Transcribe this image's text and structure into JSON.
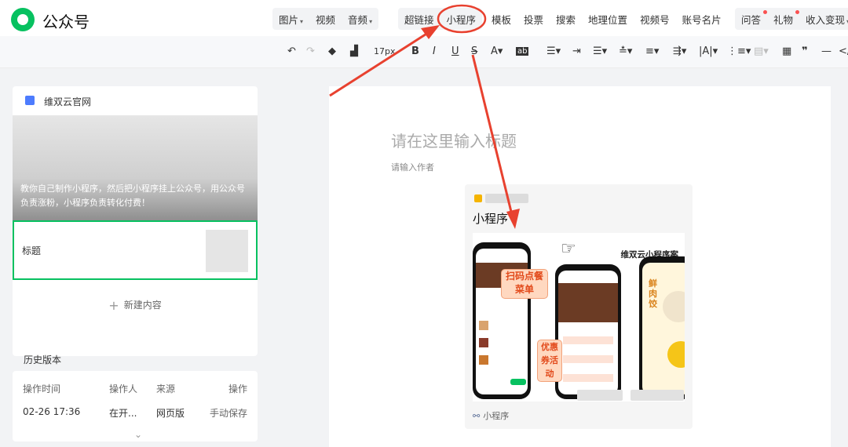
{
  "app": {
    "brand": "公众号",
    "logo_icon": "wechat-official-account-logo-icon"
  },
  "menu": {
    "group1": [
      "图片",
      "视频",
      "音频"
    ],
    "group2": [
      "超链接",
      "小程序",
      "模板",
      "投票",
      "搜索",
      "地理位置",
      "视频号",
      "账号名片"
    ],
    "plain": [
      "问答",
      "礼物",
      "收入变现"
    ],
    "highlighted": "小程序"
  },
  "toolbar": {
    "font_size": "17px",
    "icons": [
      "undo-icon",
      "redo-icon",
      "format-painter-icon",
      "clear-format-icon",
      "bold-icon",
      "italic-icon",
      "underline-icon",
      "strikethrough-icon",
      "font-color-icon",
      "background-color-icon",
      "align-icon",
      "indent-icon",
      "line-height-icon",
      "letter-spacing-icon",
      "paragraph-spacing-icon",
      "margin-icon",
      "text-direction-icon",
      "list-icon",
      "ordered-list-icon",
      "table-icon",
      "quote-icon",
      "divider-icon",
      "code-icon"
    ]
  },
  "left_panel": {
    "account_name": "维双云官网",
    "cover_text": "教你自己制作小程序，然后把小程序挂上公众号，用公众号负责涨粉，小程序负责转化付费！",
    "item_title": "标题",
    "new_content": "新建内容"
  },
  "history": {
    "title": "历史版本",
    "headers": [
      "操作时间",
      "操作人",
      "来源",
      "操作"
    ],
    "rows": [
      [
        "02-26 17:36",
        "在开...",
        "网页版",
        "手动保存"
      ]
    ]
  },
  "editor": {
    "title_placeholder": "请在这里输入标题",
    "author_placeholder": "请输入作者",
    "mini_program_label": "小程序",
    "mini_program_footer": "小程序",
    "banner_text": "维双云小程序案",
    "pill_1": "扫码点餐菜单",
    "pill_2": "优惠券活动",
    "side_text": "鲜肉饺"
  },
  "colors": {
    "accent": "#07c160",
    "annotation": "#e8412f",
    "link": "#576b95"
  }
}
